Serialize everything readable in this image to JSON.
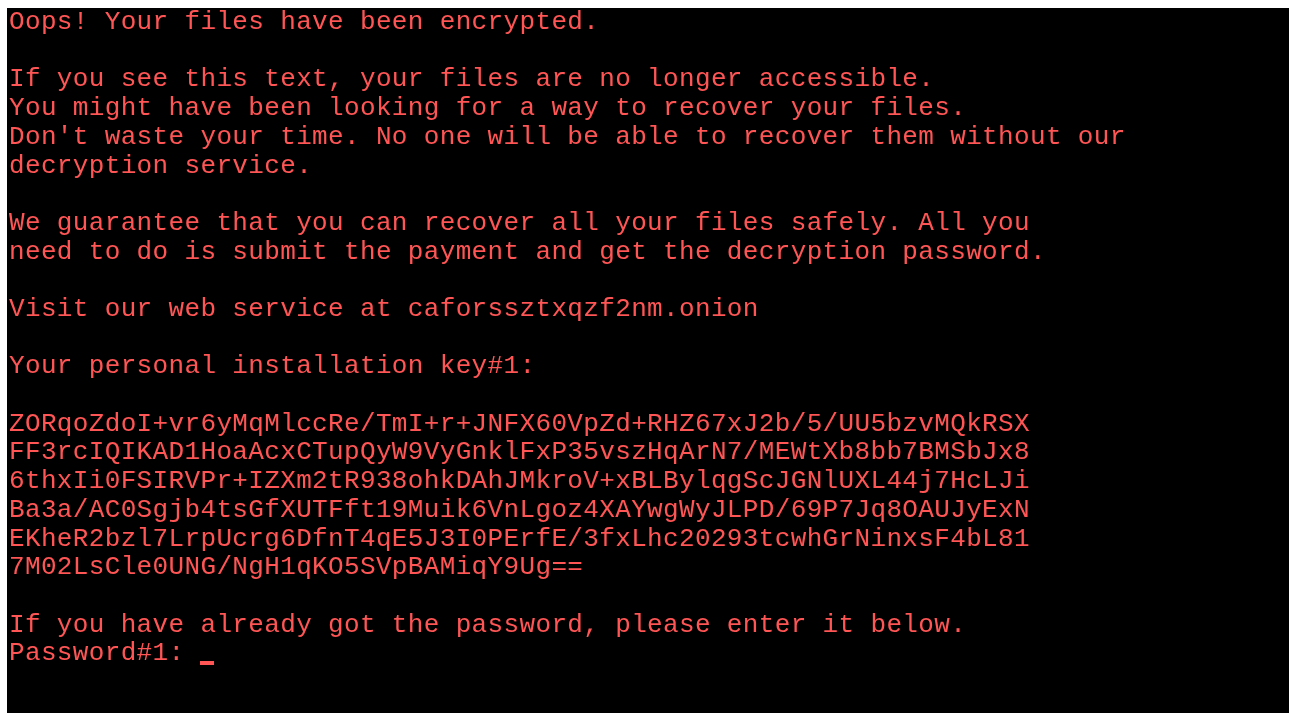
{
  "paragraphs": [
    {
      "lines": [
        "Oops! Your files have been encrypted."
      ]
    },
    {
      "lines": [
        "If you see this text, your files are no longer accessible.",
        "You might have been looking for a way to recover your files.",
        "Don't waste your time. No one will be able to recover them without our",
        "decryption service."
      ]
    },
    {
      "lines": [
        "We guarantee that you can recover all your files safely. All you",
        "need to do is submit the payment and get the decryption password."
      ]
    },
    {
      "lines": [
        "Visit our web service at caforssztxqzf2nm.onion"
      ]
    },
    {
      "lines": [
        "Your personal installation key#1:"
      ]
    },
    {
      "lines": [
        "ZORqoZdoI+vr6yMqMlccRe/TmI+r+JNFX60VpZd+RHZ67xJ2b/5/UU5bzvMQkRSX",
        "FF3rcIQIKAD1HoaAcxCTupQyW9VyGnklFxP35vszHqArN7/MEWtXb8bb7BMSbJx8",
        "6thxIi0FSIRVPr+IZXm2tR938ohkDAhJMkroV+xBLBylqgScJGNlUXL44j7HcLJi",
        "Ba3a/AC0Sgjb4tsGfXUTFft19Muik6VnLgoz4XAYwgWyJLPD/69P7Jq8OAUJyExN",
        "EKheR2bzl7LrpUcrg6DfnT4qE5J3I0PErfE/3fxLhc20293tcwhGrNinxsF4bL81",
        "7M02LsCle0UNG/NgH1qKO5SVpBAMiqY9Ug=="
      ]
    },
    {
      "lines": [
        "If you have already got the password, please enter it below."
      ]
    }
  ],
  "prompt": {
    "label": "Password#1:",
    "cursor": true
  }
}
